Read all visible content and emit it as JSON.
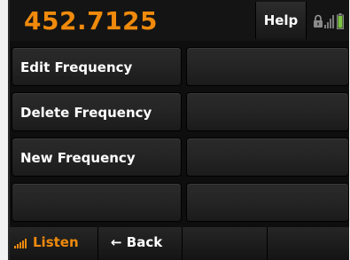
{
  "header": {
    "frequency": "452.7125",
    "help_label": "Help"
  },
  "status_icons": [
    "lock-icon",
    "signal-icon",
    "battery-icon"
  ],
  "menu": {
    "items": [
      {
        "label": "Edit Frequency"
      },
      {
        "label": "Delete Frequency"
      },
      {
        "label": "New Frequency"
      },
      {
        "label": ""
      }
    ],
    "right_items": [
      {
        "label": ""
      },
      {
        "label": ""
      },
      {
        "label": ""
      },
      {
        "label": ""
      }
    ]
  },
  "softkeys": {
    "listen_label": "Listen",
    "back_label": "← Back",
    "key3_label": "",
    "key4_label": ""
  },
  "colors": {
    "accent": "#f08a0c",
    "background": "#0e0e0e",
    "button": "#252525",
    "text": "#ffffff"
  }
}
